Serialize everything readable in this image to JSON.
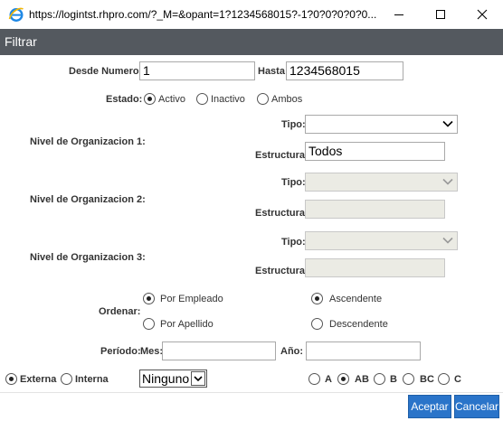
{
  "window": {
    "title": "https://logintst.rhpro.com/?_M=&opant=1?1234568015?-1?0?0?0?0?0..."
  },
  "dialog": {
    "header": "Filtrar"
  },
  "form": {
    "desde_label": "Desde Numero:",
    "desde_value": "1",
    "hasta_label": "Hasta",
    "hasta_value": "1234568015",
    "estado_label": "Estado:",
    "estado_options": [
      "Activo",
      "Inactivo",
      "Ambos"
    ],
    "estado_selected": "Activo",
    "org_levels": [
      {
        "label": "Nivel de Organizacion 1:",
        "tipo_label": "Tipo:",
        "tipo_value": "",
        "estructura_label": "Estructura:",
        "estructura_value": "Todos",
        "enabled": true
      },
      {
        "label": "Nivel de Organizacion 2:",
        "tipo_label": "Tipo:",
        "tipo_value": "",
        "estructura_label": "Estructura:",
        "estructura_value": "",
        "enabled": false
      },
      {
        "label": "Nivel de Organizacion 3:",
        "tipo_label": "Tipo:",
        "tipo_value": "",
        "estructura_label": "Estructura:",
        "estructura_value": "",
        "enabled": false
      }
    ],
    "ordenar_label": "Ordenar:",
    "ordenar_options": [
      "Por Empleado",
      "Por Apellido"
    ],
    "ordenar_selected": "Por Empleado",
    "direccion_options": [
      "Ascendente",
      "Descendente"
    ],
    "direccion_selected": "Ascendente",
    "periodo_label": "Período:",
    "mes_label": "Mes:",
    "mes_value": "",
    "anio_label": "Año:",
    "anio_value": "",
    "origen_options": [
      "Externa",
      "Interna"
    ],
    "origen_selected": "Externa",
    "ninguno_value": "Ninguno",
    "clase_options": [
      "A",
      "AB",
      "B",
      "BC",
      "C"
    ],
    "clase_selected": "AB"
  },
  "buttons": {
    "aceptar": "Aceptar",
    "cancelar": "Cancelar"
  },
  "colors": {
    "header_bg": "#54595f",
    "button_bg": "#2a74c9"
  }
}
